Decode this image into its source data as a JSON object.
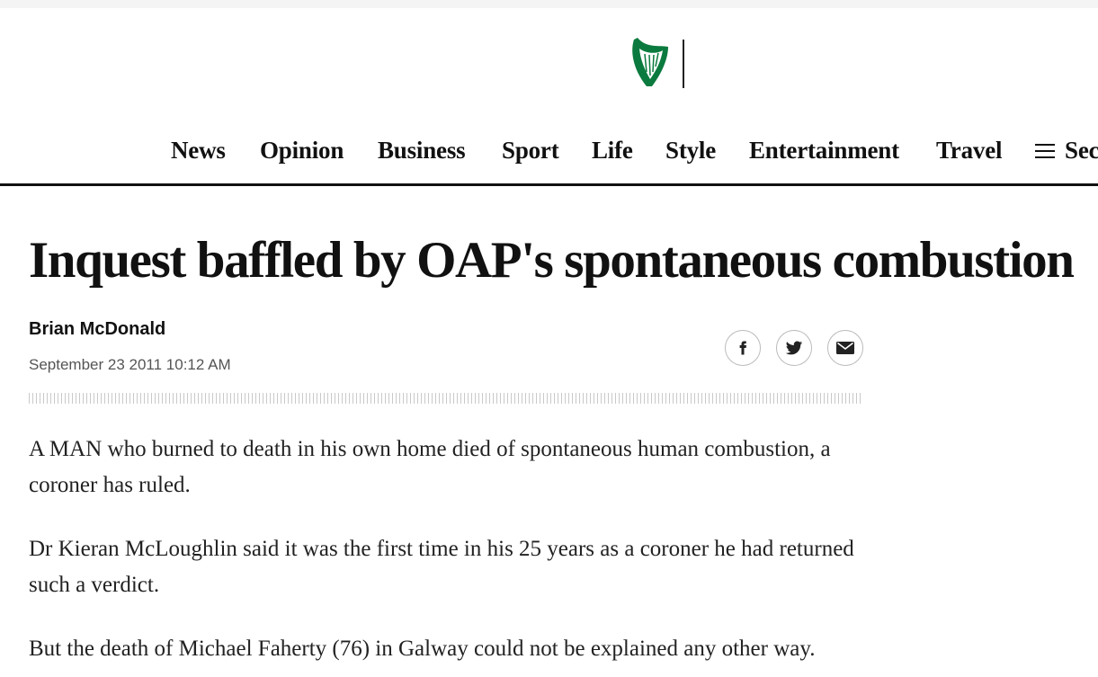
{
  "header": {
    "logo_icon": "harp-icon",
    "brand_color": "#0b7a3e"
  },
  "nav": {
    "items": [
      "News",
      "Opinion",
      "Business",
      "Sport",
      "Life",
      "Style",
      "Entertainment",
      "Travel"
    ],
    "sections_label": "Sec",
    "menu_icon": "hamburger-icon"
  },
  "article": {
    "headline": "Inquest baffled by OAP's spontaneous combustion",
    "author": "Brian McDonald",
    "date": "September 23 2011 10:12 AM",
    "share": {
      "icons": [
        "facebook-icon",
        "twitter-icon",
        "email-icon"
      ]
    },
    "paragraphs": [
      "A MAN who burned to death in his own home died of spontaneous human combustion, a coroner has ruled.",
      "Dr Kieran McLoughlin said it was the first time in his 25 years as a coroner he had returned such a verdict.",
      "But the death of Michael Faherty (76) in Galway could not be explained any other way."
    ]
  }
}
